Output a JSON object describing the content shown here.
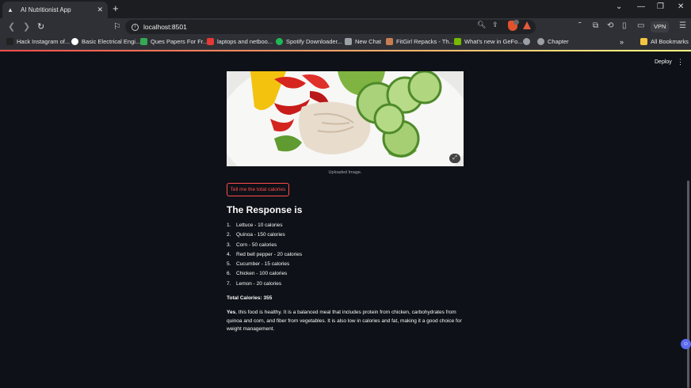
{
  "browser": {
    "tab_title": "AI Nutritionist App",
    "url": "localhost:8501",
    "vpn_label": "VPN",
    "bookmarks": [
      {
        "label": "Hack Instagram of...",
        "icon": "dark-icon",
        "color": "#222"
      },
      {
        "label": "Basic Electrical Engi...",
        "icon": "google-icon",
        "color": "#ffffff"
      },
      {
        "label": "Ques Papers For Fr...",
        "icon": "drive-icon",
        "color": "#34a853"
      },
      {
        "label": "laptops and netboo...",
        "icon": "l-icon",
        "color": "#e53935"
      },
      {
        "label": "Spotify Downloader...",
        "icon": "spotify-icon",
        "color": "#1db954"
      },
      {
        "label": "New Chat",
        "icon": "chat-icon",
        "color": "#9aa0a6"
      },
      {
        "label": "FitGirl Repacks - Th...",
        "icon": "fitgirl-icon",
        "color": "#c77d4f"
      },
      {
        "label": "What's new in GeFo...",
        "icon": "nvidia-icon",
        "color": "#76b900"
      },
      {
        "label": "",
        "icon": "globe-icon",
        "color": "#9aa0a6"
      },
      {
        "label": "Chapter",
        "icon": "globe-icon",
        "color": "#9aa0a6"
      }
    ],
    "all_bookmarks": "All Bookmarks"
  },
  "app": {
    "deploy_label": "Deploy",
    "image_caption": "Uploaded Image.",
    "button_label": "Tell me the total calories",
    "response_heading": "The Response is",
    "items": [
      {
        "num": "1.",
        "text": "Lettuce - 10 calories"
      },
      {
        "num": "2.",
        "text": "Quinoa - 150 calories"
      },
      {
        "num": "3.",
        "text": "Corn - 50 calories"
      },
      {
        "num": "4.",
        "text": "Red bell pepper - 20 calories"
      },
      {
        "num": "5.",
        "text": "Cucumber - 15 calories"
      },
      {
        "num": "6.",
        "text": "Chicken - 100 calories"
      },
      {
        "num": "7.",
        "text": "Lemon - 20 calories"
      }
    ],
    "total": "Total Calories: 355",
    "verdict_bold": "Yes",
    "verdict_text": ", this food is healthy. It is a balanced meal that includes protein from chicken, carbohydrates from quinoa and corn, and fiber from vegetables. It is also low in calories and fat, making it a good choice for weight management."
  },
  "colors": {
    "background": "#0e1117",
    "accent": "#ff4b4b"
  }
}
